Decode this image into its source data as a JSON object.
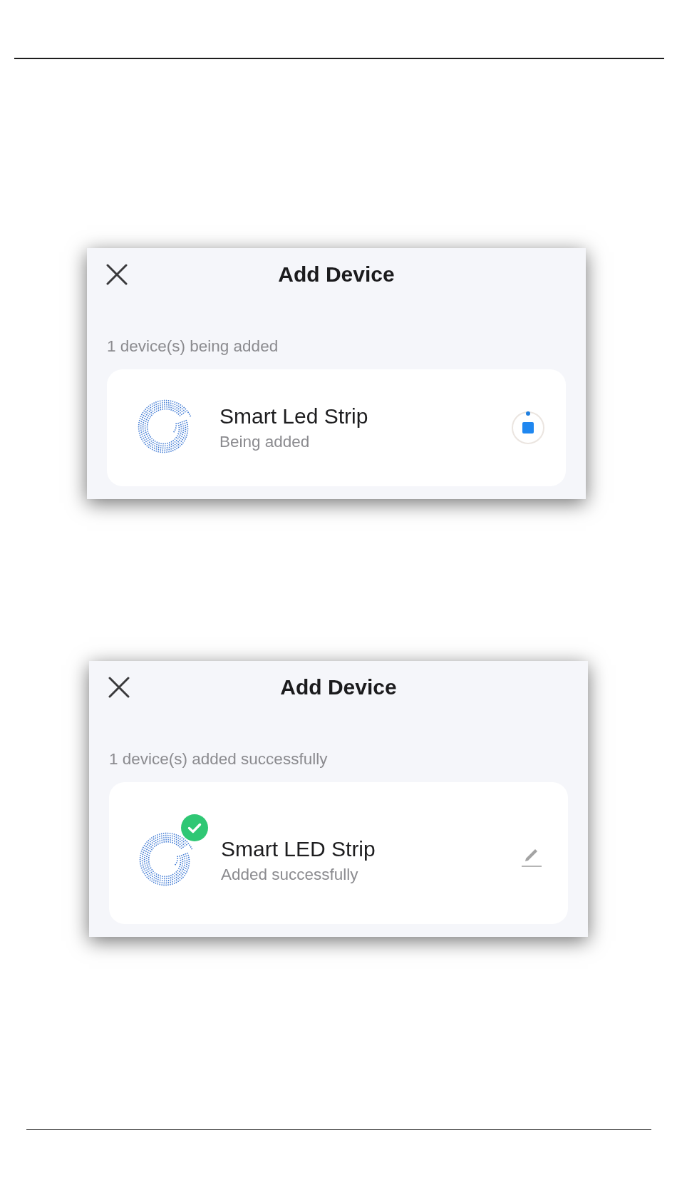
{
  "screens": [
    {
      "title": "Add Device",
      "summary": "1 device(s) being added",
      "devices": [
        {
          "kind": "adding",
          "name": "Smart Led Strip",
          "status": "Being added"
        }
      ]
    },
    {
      "title": "Add Device",
      "summary": "1 device(s) added successfully",
      "devices": [
        {
          "kind": "added",
          "name": "Smart LED Strip",
          "status": "Added successfully"
        }
      ]
    }
  ]
}
